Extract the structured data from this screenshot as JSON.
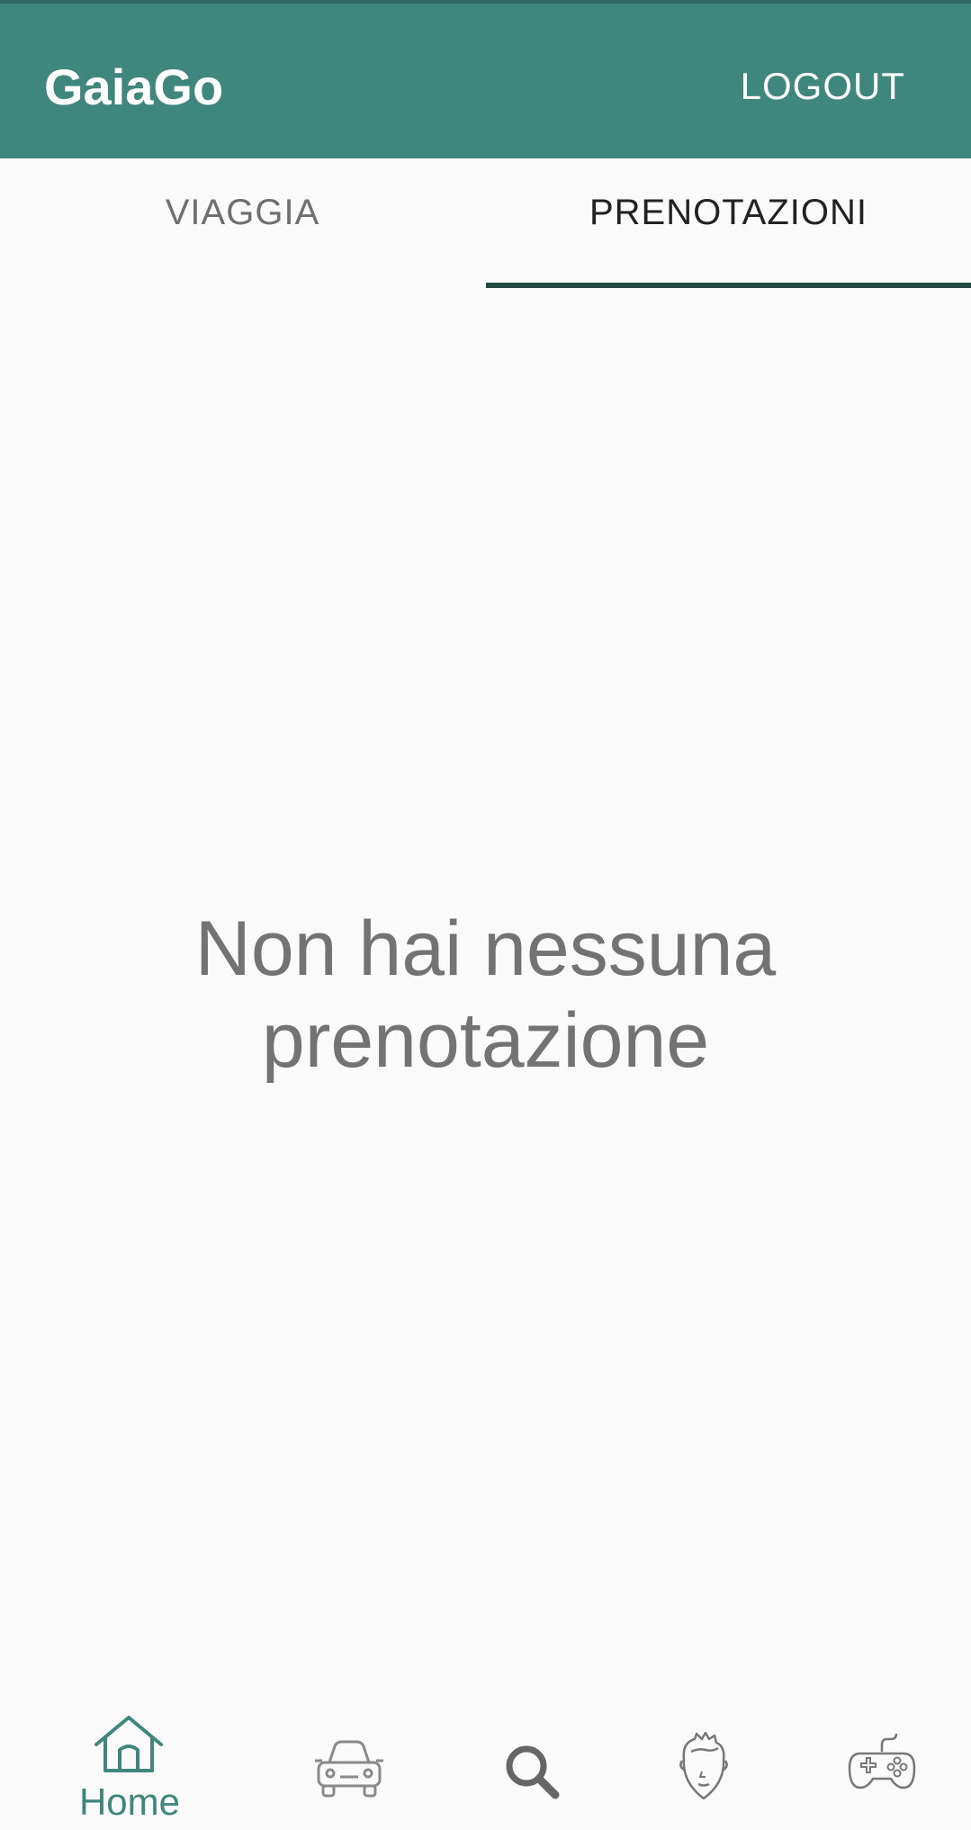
{
  "app_bar": {
    "title": "GaiaGo",
    "logout_label": "LOGOUT",
    "background_color": "#3f877d"
  },
  "tabs": [
    {
      "label": "VIAGGIA",
      "selected": false
    },
    {
      "label": "PRENOTAZIONI",
      "selected": true
    }
  ],
  "main": {
    "empty_line_1": "Non hai nessuna",
    "empty_line_2": "prenotazione"
  },
  "bottom_nav": {
    "items": [
      {
        "label": "Home",
        "icon": "home-icon",
        "selected": true
      },
      {
        "label": "",
        "icon": "car-icon",
        "selected": false
      },
      {
        "label": "",
        "icon": "search-icon",
        "selected": false
      },
      {
        "label": "",
        "icon": "profile-face-icon",
        "selected": false
      },
      {
        "label": "",
        "icon": "gamepad-icon",
        "selected": false
      }
    ],
    "active_color": "#3f877d",
    "inactive_color": "#6f6f6f"
  }
}
